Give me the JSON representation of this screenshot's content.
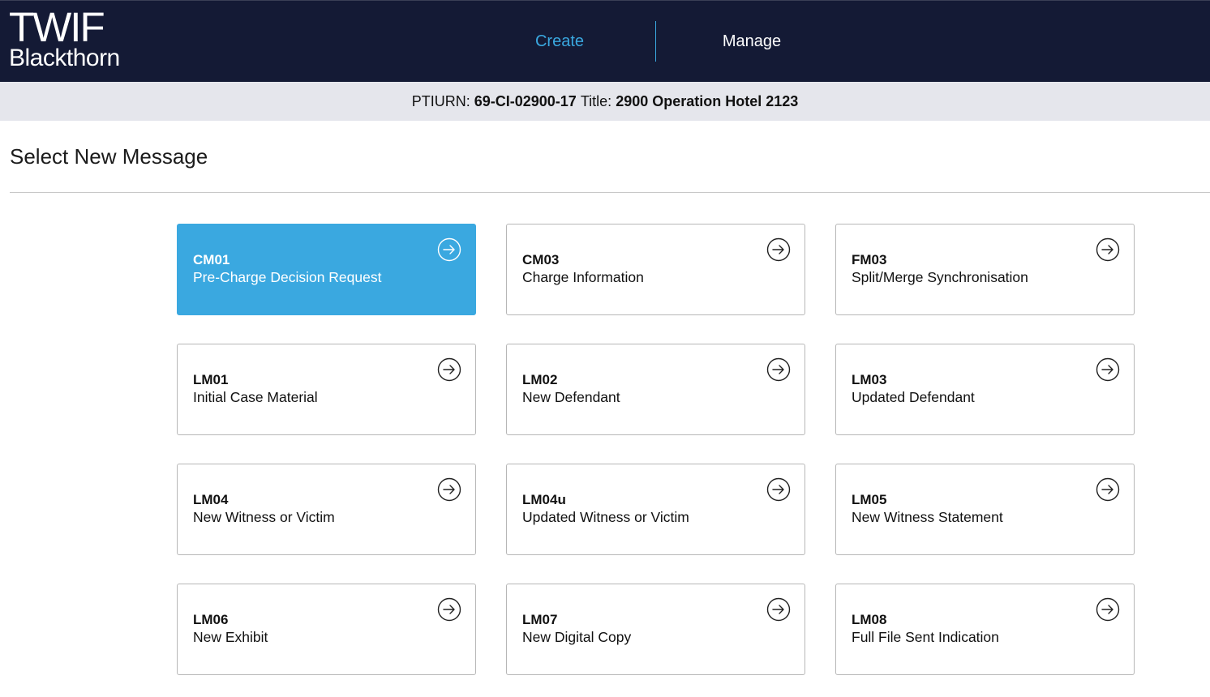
{
  "header": {
    "logo_top": "TWIF",
    "logo_bottom": "Blackthorn",
    "nav": {
      "create": "Create",
      "manage": "Manage"
    },
    "accent_color": "#3aa8e0",
    "bg_color": "#141a35"
  },
  "case": {
    "ptiurn_label": "PTIURN:",
    "ptiurn_value": "69-CI-02900-17",
    "title_label": "Title:",
    "title_value": "2900 Operation Hotel 2123"
  },
  "page": {
    "title": "Select New Message"
  },
  "messages": [
    {
      "code": "CM01",
      "title": "Pre-Charge Decision Request",
      "selected": true,
      "icon": "arrow-circle-right-icon"
    },
    {
      "code": "CM03",
      "title": "Charge Information",
      "selected": false,
      "icon": "arrow-circle-right-icon"
    },
    {
      "code": "FM03",
      "title": "Split/Merge Synchronisation",
      "selected": false,
      "icon": "arrow-circle-right-icon"
    },
    {
      "code": "LM01",
      "title": "Initial Case Material",
      "selected": false,
      "icon": "arrow-circle-right-icon"
    },
    {
      "code": "LM02",
      "title": "New Defendant",
      "selected": false,
      "icon": "arrow-circle-right-icon"
    },
    {
      "code": "LM03",
      "title": "Updated Defendant",
      "selected": false,
      "icon": "arrow-circle-right-icon"
    },
    {
      "code": "LM04",
      "title": "New Witness or Victim",
      "selected": false,
      "icon": "arrow-circle-right-icon"
    },
    {
      "code": "LM04u",
      "title": "Updated Witness or Victim",
      "selected": false,
      "icon": "arrow-circle-right-icon"
    },
    {
      "code": "LM05",
      "title": "New Witness Statement",
      "selected": false,
      "icon": "arrow-circle-right-icon"
    },
    {
      "code": "LM06",
      "title": "New Exhibit",
      "selected": false,
      "icon": "arrow-circle-right-icon"
    },
    {
      "code": "LM07",
      "title": "New Digital Copy",
      "selected": false,
      "icon": "arrow-circle-right-icon"
    },
    {
      "code": "LM08",
      "title": "Full File Sent Indication",
      "selected": false,
      "icon": "arrow-circle-right-icon"
    }
  ]
}
